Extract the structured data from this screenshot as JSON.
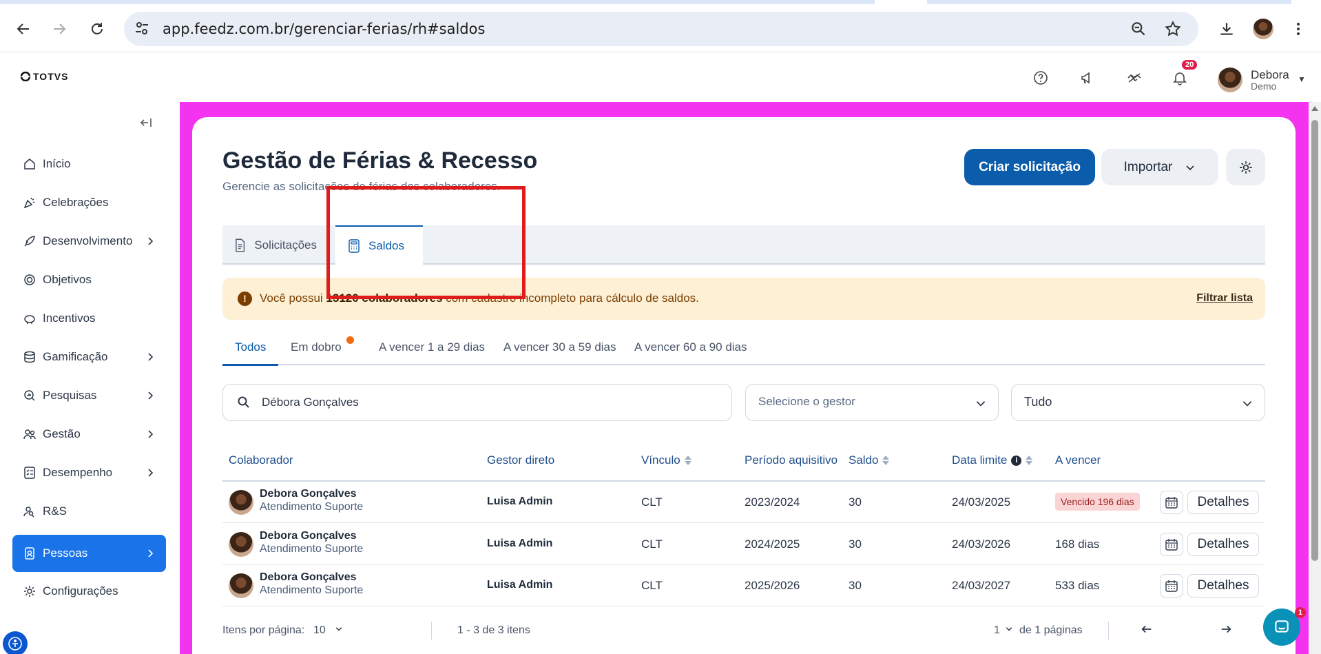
{
  "browser": {
    "url": "app.feedz.com.br/gerenciar-ferias/rh#saldos"
  },
  "header": {
    "logo_text": "TOTVS",
    "notification_count": "20",
    "user_name": "Debora",
    "user_role": "Demo"
  },
  "sidebar": {
    "items": [
      {
        "label": "Início",
        "icon": "home-icon"
      },
      {
        "label": "Celebrações",
        "icon": "party-icon"
      },
      {
        "label": "Desenvolvimento",
        "icon": "rocket-icon"
      },
      {
        "label": "Objetivos",
        "icon": "target-icon"
      },
      {
        "label": "Incentivos",
        "icon": "piggy-bank-icon"
      },
      {
        "label": "Gamificação",
        "icon": "coins-icon"
      },
      {
        "label": "Pesquisas",
        "icon": "survey-icon"
      },
      {
        "label": "Gestão",
        "icon": "people-icon"
      },
      {
        "label": "Desempenho",
        "icon": "checklist-icon"
      },
      {
        "label": "R&S",
        "icon": "user-search-icon"
      },
      {
        "label": "Pessoas",
        "icon": "id-badge-icon"
      },
      {
        "label": "Configurações",
        "icon": "gear-icon"
      }
    ],
    "active_item": "Pessoas"
  },
  "page": {
    "title": "Gestão de Férias & Recesso",
    "subtitle": "Gerencie as solicitações de férias dos colaboradores.",
    "create_button": "Criar solicitação",
    "import_button": "Importar",
    "tabs": [
      {
        "label": "Solicitações",
        "active": false
      },
      {
        "label": "Saldos",
        "active": true
      }
    ]
  },
  "alert": {
    "prefix": "Você possui ",
    "bold": "13120 colaboradores",
    "suffix": " com cadastro incompleto para cálculo de saldos.",
    "link": "Filtrar lista"
  },
  "subtabs": [
    {
      "label": "Todos",
      "active": true
    },
    {
      "label": "Em dobro",
      "has_dot": true
    },
    {
      "label": "A vencer 1 a 29 dias"
    },
    {
      "label": "A vencer 30 a 59 dias"
    },
    {
      "label": "A vencer 60 a 90 dias"
    }
  ],
  "filters": {
    "search_value": "Débora Gonçalves",
    "manager_placeholder": "Selecione o gestor",
    "status_value": "Tudo"
  },
  "table": {
    "columns": [
      "Colaborador",
      "Gestor direto",
      "Vínculo",
      "Período aquisitivo",
      "Saldo",
      "Data limite",
      "A vencer"
    ],
    "rows": [
      {
        "name": "Debora Gonçalves",
        "dept": "Atendimento Suporte",
        "manager": "Luisa Admin",
        "vinculo": "CLT",
        "periodo": "2023/2024",
        "saldo": "30",
        "data_limite": "24/03/2025",
        "a_vencer": "Vencido 196 dias",
        "action": "Detalhes"
      },
      {
        "name": "Debora Gonçalves",
        "dept": "Atendimento Suporte",
        "manager": "Luisa Admin",
        "vinculo": "CLT",
        "periodo": "2024/2025",
        "saldo": "30",
        "data_limite": "24/03/2026",
        "a_vencer": "168 dias",
        "action": "Detalhes"
      },
      {
        "name": "Debora Gonçalves",
        "dept": "Atendimento Suporte",
        "manager": "Luisa Admin",
        "vinculo": "CLT",
        "periodo": "2025/2026",
        "saldo": "30",
        "data_limite": "24/03/2027",
        "a_vencer": "533 dias",
        "action": "Detalhes"
      }
    ]
  },
  "pagination": {
    "per_page_label": "Itens por página:",
    "per_page_value": "10",
    "range_text": "1 - 3 de 3 itens",
    "current_page": "1",
    "total_pages_text": "de 1 páginas"
  },
  "chat": {
    "badge": "1"
  },
  "colors": {
    "accent": "#0b5cab",
    "sidebar_active": "#1a73e8",
    "frame": "#f433f0",
    "highlight_box": "#e01b1b"
  }
}
